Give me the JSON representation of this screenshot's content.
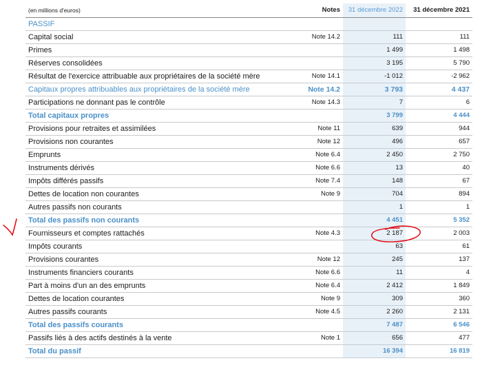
{
  "header": {
    "unit_label": "(en millions d'euros)",
    "notes": "Notes",
    "col_2022": "31 décembre 2022",
    "col_2021": "31 décembre 2021"
  },
  "section": "PASSIF",
  "rows": [
    {
      "label": "Capital social",
      "note": "Note 14.2",
      "v2022": "111",
      "v2021": "111"
    },
    {
      "label": "Primes",
      "note": "",
      "v2022": "1 499",
      "v2021": "1 498"
    },
    {
      "label": "Réserves consolidées",
      "note": "",
      "v2022": "3 195",
      "v2021": "5 790"
    },
    {
      "label": "Résultat de l'exercice attribuable aux propriétaires de la société mère",
      "note": "Note 14.1",
      "v2022": "-1 012",
      "v2021": "-2 962"
    },
    {
      "label": "Capitaux propres attribuables aux propriétaires de la société mère",
      "note": "Note 14.2",
      "v2022": "3 793",
      "v2021": "4 437"
    },
    {
      "label": "Participations ne donnant pas le contrôle",
      "note": "Note 14.3",
      "v2022": "7",
      "v2021": "6"
    },
    {
      "label": "Total capitaux propres",
      "note": "",
      "v2022": "3 799",
      "v2021": "4 444"
    },
    {
      "label": "Provisions pour retraites et assimilées",
      "note": "Note 11",
      "v2022": "639",
      "v2021": "944"
    },
    {
      "label": "Provisions non courantes",
      "note": "Note 12",
      "v2022": "496",
      "v2021": "657"
    },
    {
      "label": "Emprunts",
      "note": "Note 6.4",
      "v2022": "2 450",
      "v2021": "2 750"
    },
    {
      "label": "Instruments dérivés",
      "note": "Note 6.6",
      "v2022": "13",
      "v2021": "40"
    },
    {
      "label": "Impôts différés passifs",
      "note": "Note 7.4",
      "v2022": "148",
      "v2021": "67"
    },
    {
      "label": "Dettes de location non courantes",
      "note": "Note 9",
      "v2022": "704",
      "v2021": "894"
    },
    {
      "label": "Autres passifs non courants",
      "note": "",
      "v2022": "1",
      "v2021": "1"
    },
    {
      "label": "Total des passifs non courants",
      "note": "",
      "v2022": "4 451",
      "v2021": "5 352"
    },
    {
      "label": "Fournisseurs et comptes rattachés",
      "note": "Note 4.3",
      "v2022": "2 187",
      "v2021": "2 003"
    },
    {
      "label": "Impôts courants",
      "note": "",
      "v2022": "63",
      "v2021": "61"
    },
    {
      "label": "Provisions courantes",
      "note": "Note 12",
      "v2022": "245",
      "v2021": "137"
    },
    {
      "label": "Instruments financiers courants",
      "note": "Note 6.6",
      "v2022": "11",
      "v2021": "4"
    },
    {
      "label": "Part à moins d'un an des emprunts",
      "note": "Note 6.4",
      "v2022": "2 412",
      "v2021": "1 849"
    },
    {
      "label": "Dettes de location courantes",
      "note": "Note 9",
      "v2022": "309",
      "v2021": "360"
    },
    {
      "label": "Autres passifs courants",
      "note": "Note 4.5",
      "v2022": "2 260",
      "v2021": "2 131"
    },
    {
      "label": "Total des passifs courants",
      "note": "",
      "v2022": "7 487",
      "v2021": "6 546"
    },
    {
      "label": "Passifs liés à des actifs destinés à la vente",
      "note": "Note 1",
      "v2022": "656",
      "v2021": "477"
    },
    {
      "label": "Total du passif",
      "note": "",
      "v2022": "16 394",
      "v2021": "16 819"
    }
  ],
  "colors": {
    "accent": "#4a90c8",
    "highlight_column": "#e9f1f8",
    "annotation": "#e3121b"
  }
}
